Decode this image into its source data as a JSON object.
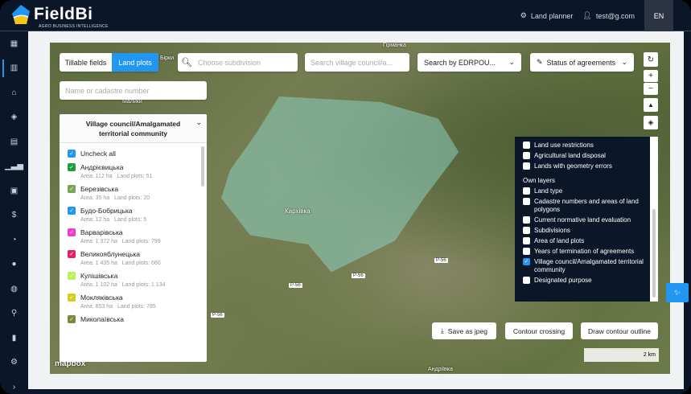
{
  "header": {
    "logo": "FieldBi",
    "logo_sub": "AGRO BUSINESS INTELLIGENCE",
    "role": "Land planner",
    "user": "test@g.com",
    "lang": "EN"
  },
  "sidebar": [
    "dashboard-icon",
    "map-icon",
    "farm-icon",
    "layers-icon",
    "document-icon",
    "chart-icon",
    "clipboard-icon",
    "money-icon",
    "pie-icon",
    "chat-icon",
    "globe-icon",
    "search-user-icon",
    "book-icon",
    "settings-icon",
    "expand-icon"
  ],
  "toolbar": {
    "tab_tillable": "Tillable fields",
    "tab_land": "Land plots",
    "subdivision_placeholder": "Choose subdivision",
    "village_placeholder": "Search village council/a...",
    "edrpou": "Search by EDRPOU...",
    "status": "Status of agreements",
    "cadastre_placeholder": "Name or cadastre number"
  },
  "panel": {
    "title": "Village council/Amalgamated territorial community",
    "uncheck": "Uncheck all",
    "items": [
      {
        "name": "Андрієвицька",
        "area": "Area: 112 ha",
        "plots": "Land plots: 51",
        "color": "#1e9e3a"
      },
      {
        "name": "Березівська",
        "area": "Area: 35 ha",
        "plots": "Land plots: 20",
        "color": "#7aa356"
      },
      {
        "name": "Будо-Бобрицька",
        "area": "Area: 12 ha",
        "plots": "Land plots: 5",
        "color": "#2196f3"
      },
      {
        "name": "Варварівська",
        "area": "Area: 1 372 ha",
        "plots": "Land plots: 799",
        "color": "#f03cc8"
      },
      {
        "name": "Великояблунецька",
        "area": "Area: 1 435 ha",
        "plots": "Land plots: 660",
        "color": "#e0226a"
      },
      {
        "name": "Кулішівська",
        "area": "Area: 1 102 ha",
        "plots": "Land plots: 1 134",
        "color": "#b8f25a"
      },
      {
        "name": "Мокляківська",
        "area": "Area: 853 ha",
        "plots": "Land plots: 785",
        "color": "#d6cc1a"
      },
      {
        "name": "Миколаївська",
        "area": "",
        "plots": "",
        "color": "#7a8a3a"
      }
    ]
  },
  "layers": {
    "items_top": [
      {
        "label": "Land use restrictions",
        "checked": false
      },
      {
        "label": "Agricultural land disposal",
        "checked": false
      },
      {
        "label": "Lands with geometry errors",
        "checked": false
      }
    ],
    "own_header": "Own layers",
    "own": [
      {
        "label": "Land type",
        "checked": false
      },
      {
        "label": "Cadastre numbers and areas of land polygons",
        "checked": false
      },
      {
        "label": "Current normative land evaluation",
        "checked": false
      },
      {
        "label": "Subdivisions",
        "checked": false
      },
      {
        "label": "Area of land plots",
        "checked": false
      },
      {
        "label": "Years of termination of agreements",
        "checked": false
      },
      {
        "label": "Village council/Amalgamated territorial community",
        "checked": true
      },
      {
        "label": "Designated purpose",
        "checked": false
      }
    ]
  },
  "map": {
    "labels": [
      "Гірманка",
      "Бірки",
      "Малики",
      "Кархівка",
      "Андріївка"
    ],
    "roads": [
      "P-56",
      "P-56",
      "P-56",
      "P-56"
    ],
    "scale": "2 km",
    "attribution": "mapbox"
  },
  "buttons": {
    "save": "Save as jpeg",
    "crossing": "Contour crossing",
    "draw": "Draw contour outline"
  }
}
